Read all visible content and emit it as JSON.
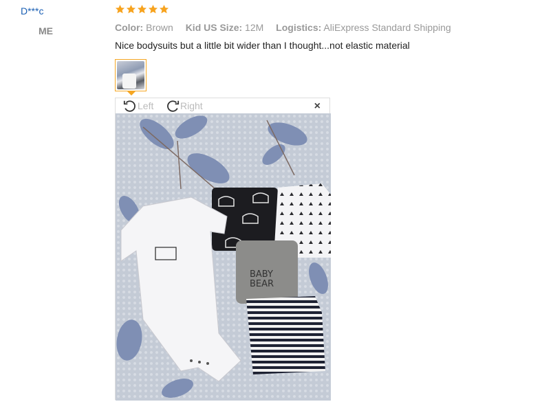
{
  "reviewer": {
    "name": "D***c",
    "country": "ME"
  },
  "review": {
    "rating": 5,
    "attributes": [
      {
        "key": "Color:",
        "value": "Brown"
      },
      {
        "key": "Kid US Size:",
        "value": "12M"
      },
      {
        "key": "Logistics:",
        "value": "AliExpress Standard Shipping"
      }
    ],
    "feedback": "Nice bodysuits but a little bit wider than I thought...not elastic material"
  },
  "viewer": {
    "rotate_left_label": "Left",
    "rotate_right_label": "Right",
    "close_glyph": "×",
    "photo_text": {
      "line1": "BABY",
      "line2": "BEAR"
    }
  },
  "colors": {
    "accent": "#f5a623",
    "star": "#f7a31e",
    "link": "#1a5fb4"
  }
}
